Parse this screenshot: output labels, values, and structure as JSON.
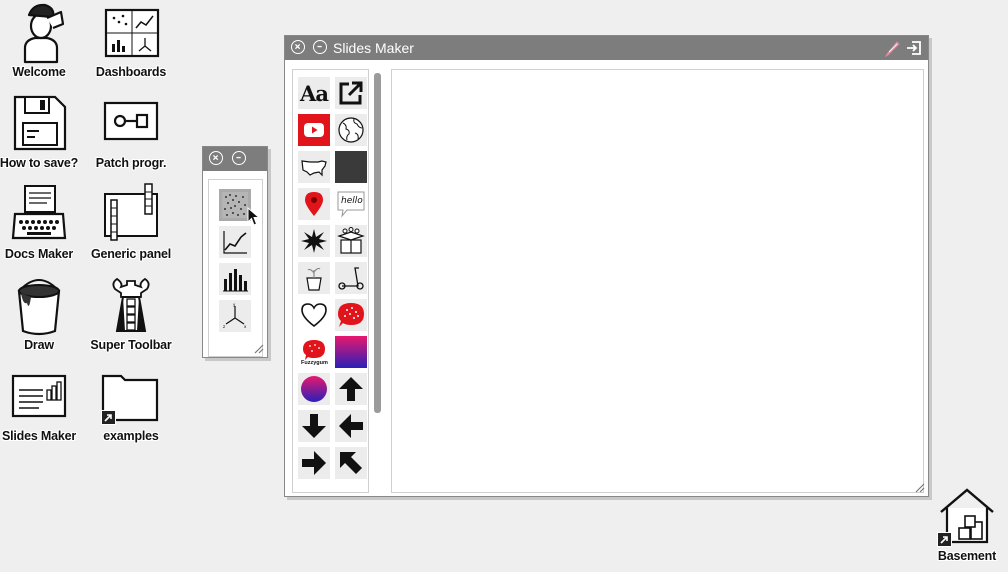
{
  "desktop": {
    "icons": [
      {
        "label": "Welcome"
      },
      {
        "label": "Dashboards"
      },
      {
        "label": "How to save?"
      },
      {
        "label": "Patch progr."
      },
      {
        "label": "Docs Maker"
      },
      {
        "label": "Generic panel"
      },
      {
        "label": "Draw"
      },
      {
        "label": "Super Toolbar"
      },
      {
        "label": "Slides Maker"
      },
      {
        "label": "examples"
      },
      {
        "label": "Basement"
      }
    ]
  },
  "slides_window": {
    "title": "Slides Maker",
    "palette_items": [
      {
        "icon": "text-icon",
        "text": "Aa"
      },
      {
        "icon": "external-link-icon"
      },
      {
        "icon": "youtube-icon"
      },
      {
        "icon": "globe-icon"
      },
      {
        "icon": "us-map-icon"
      },
      {
        "icon": "dark-square-icon"
      },
      {
        "icon": "map-pin-icon"
      },
      {
        "icon": "speech-bubble-icon",
        "text": "hello"
      },
      {
        "icon": "burst-icon"
      },
      {
        "icon": "gift-box-icon"
      },
      {
        "icon": "potted-plant-icon"
      },
      {
        "icon": "scooter-icon"
      },
      {
        "icon": "heart-icon"
      },
      {
        "icon": "red-bubble-icon"
      },
      {
        "icon": "fuzzygum-icon",
        "text": "Fuzzygum"
      },
      {
        "icon": "gradient-square-icon"
      },
      {
        "icon": "gradient-circle-icon"
      },
      {
        "icon": "arrow-up-icon"
      },
      {
        "icon": "arrow-down-icon"
      },
      {
        "icon": "arrow-left-icon"
      },
      {
        "icon": "arrow-right-icon"
      },
      {
        "icon": "arrow-up-left-icon"
      }
    ]
  },
  "chart_palette_window": {
    "items": [
      {
        "icon": "scatter-plot-icon"
      },
      {
        "icon": "line-chart-icon"
      },
      {
        "icon": "bar-chart-icon"
      },
      {
        "icon": "3d-axes-icon"
      }
    ]
  },
  "colors": {
    "titlebar": "#7d7d7d",
    "desktop": "#efefef",
    "youtube_red": "#e1141b",
    "gradient_start": "#e8186e",
    "gradient_end": "#2a1fb8"
  }
}
